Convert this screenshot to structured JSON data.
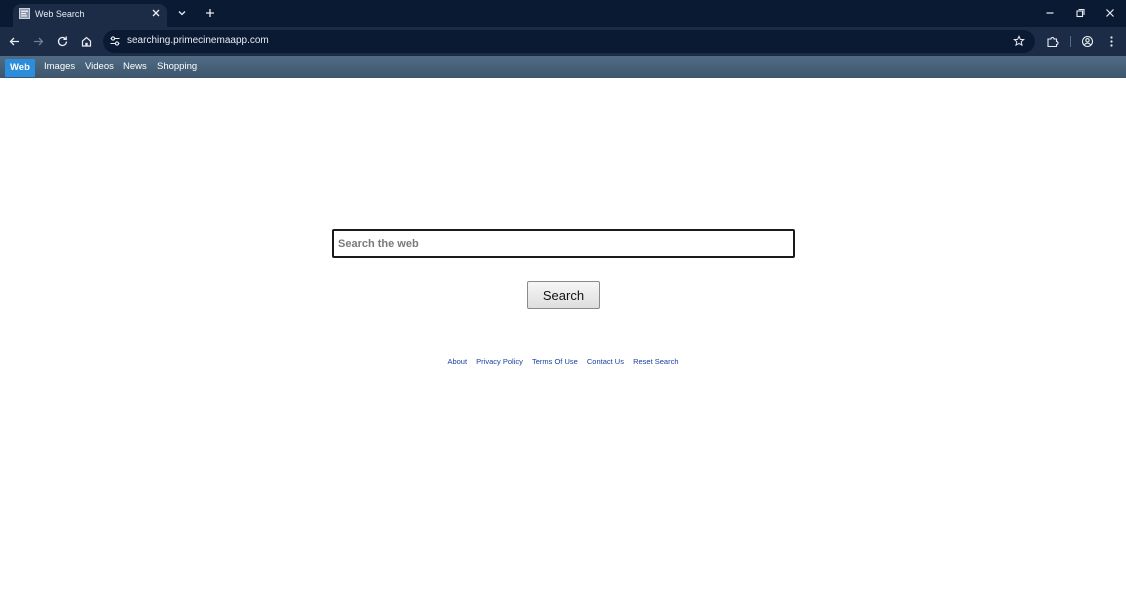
{
  "browser": {
    "tab": {
      "title": "Web Search",
      "favicon": "page-favicon-icon"
    },
    "url": "searching.primecinemaapp.com",
    "colors": {
      "frame": "#0b1a33",
      "toolbar": "#1c2c47",
      "icon": "#e8ecf3"
    }
  },
  "categories": {
    "web": "Web",
    "images": "Images",
    "videos": "Videos",
    "news": "News",
    "shopping": "Shopping"
  },
  "search": {
    "placeholder": "Search the web",
    "value": "",
    "button_label": "Search"
  },
  "footer": {
    "about": "About",
    "privacy": "Privacy Policy",
    "terms": "Terms Of Use",
    "contact": "Contact Us",
    "reset": "Reset Search"
  },
  "colors": {
    "category_active": "#2b8ddc",
    "footer_link": "#1a3fa0"
  }
}
